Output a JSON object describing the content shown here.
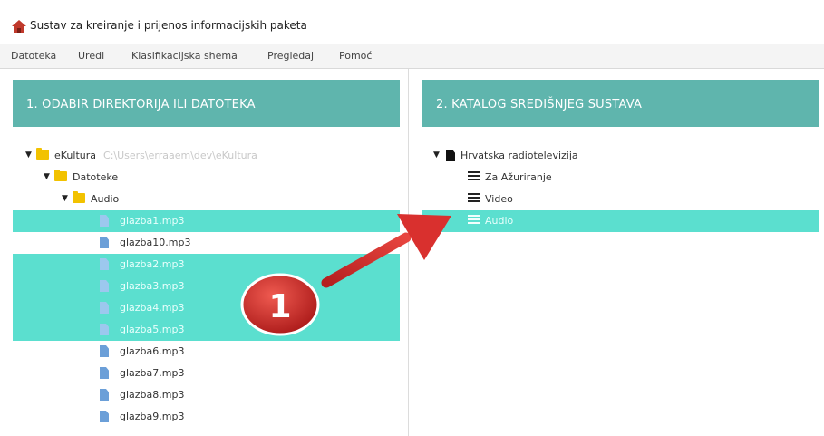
{
  "window": {
    "title": "Sustav za kreiranje i prijenos informacijskih paketa",
    "icon": "house-icon"
  },
  "menu": [
    "Datoteka",
    "Uredi",
    "Klasifikacijska shema",
    "Pregledaj",
    "Pomoć"
  ],
  "left_panel": {
    "header": "1. ODABIR DIREKTORIJA ILI DATOTEKA",
    "root": {
      "label": "eKultura",
      "path": "C:\\Users\\erraaem\\dev\\eKultura"
    },
    "folder1": "Datoteke",
    "folder2": "Audio",
    "files": [
      {
        "name": "glazba1.mp3",
        "selected": true
      },
      {
        "name": "glazba10.mp3",
        "selected": false
      },
      {
        "name": "glazba2.mp3",
        "selected": true
      },
      {
        "name": "glazba3.mp3",
        "selected": true
      },
      {
        "name": "glazba4.mp3",
        "selected": true
      },
      {
        "name": "glazba5.mp3",
        "selected": true
      },
      {
        "name": "glazba6.mp3",
        "selected": false
      },
      {
        "name": "glazba7.mp3",
        "selected": false
      },
      {
        "name": "glazba8.mp3",
        "selected": false
      },
      {
        "name": "glazba9.mp3",
        "selected": false
      }
    ]
  },
  "right_panel": {
    "header": "2. KATALOG SREDIŠNJEG SUSTAVA",
    "root": "Hrvatska radiotelevizija",
    "children": [
      {
        "name": "Za Ažuriranje",
        "selected": false
      },
      {
        "name": "Video",
        "selected": false
      },
      {
        "name": "Audio",
        "selected": true
      }
    ]
  },
  "annotation": {
    "badge": "1",
    "badge_color": "#d42b2b",
    "arrow_color": "#d9302e"
  },
  "colors": {
    "header": "#5fb5ad",
    "selection": "#5bdfcf",
    "folder": "#f2c200",
    "file": "#6b9fd8"
  }
}
